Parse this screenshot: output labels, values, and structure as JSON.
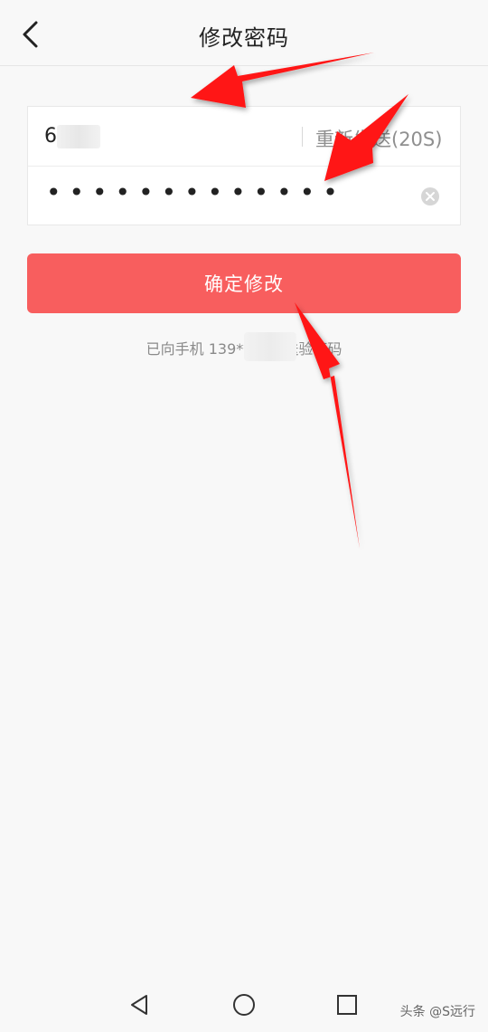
{
  "header": {
    "title": "修改密码"
  },
  "form": {
    "code_value": "6",
    "resend_label": "重新发送(20S)",
    "password_masked": "•••••••••••••"
  },
  "actions": {
    "confirm_label": "确定修改"
  },
  "hint": {
    "text": "已向手机 139****    发送验证码"
  },
  "watermark": "头条 @S远行",
  "colors": {
    "accent": "#f85e5e",
    "background": "#f8f8f8",
    "arrow": "#ff1414"
  },
  "icons": {
    "back": "back-arrow-icon",
    "clear": "clear-circle-icon",
    "nav_back": "triangle-back-icon",
    "nav_home": "circle-home-icon",
    "nav_recent": "square-recent-icon"
  }
}
